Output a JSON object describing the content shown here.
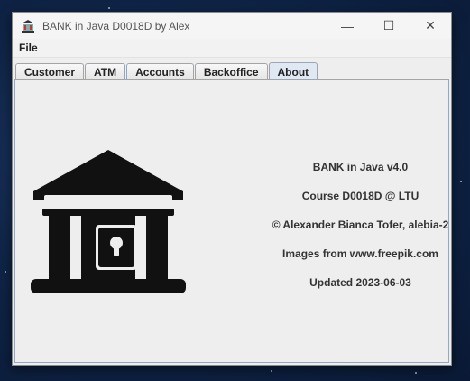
{
  "window": {
    "title": "BANK in Java D0018D by Alex",
    "controls": {
      "minimize": "—",
      "maximize": "☐",
      "close": "✕"
    }
  },
  "menu": {
    "file_label": "File"
  },
  "tabs": [
    {
      "label": "Customer",
      "active": false
    },
    {
      "label": "ATM",
      "active": false
    },
    {
      "label": "Accounts",
      "active": false
    },
    {
      "label": "Backoffice",
      "active": false
    },
    {
      "label": "About",
      "active": true
    }
  ],
  "about": {
    "lines": [
      "BANK in Java v4.0",
      "Course D0018D @ LTU",
      "© Alexander Bianca Tofer, alebia-2",
      "Images from www.freepik.com",
      "Updated 2023-06-03"
    ]
  },
  "icons": {
    "app": "bank-app-icon",
    "illustration": "bank-building-icon"
  },
  "colors": {
    "accent_active_tab": "#dfe8f3",
    "icon": "#111111"
  }
}
